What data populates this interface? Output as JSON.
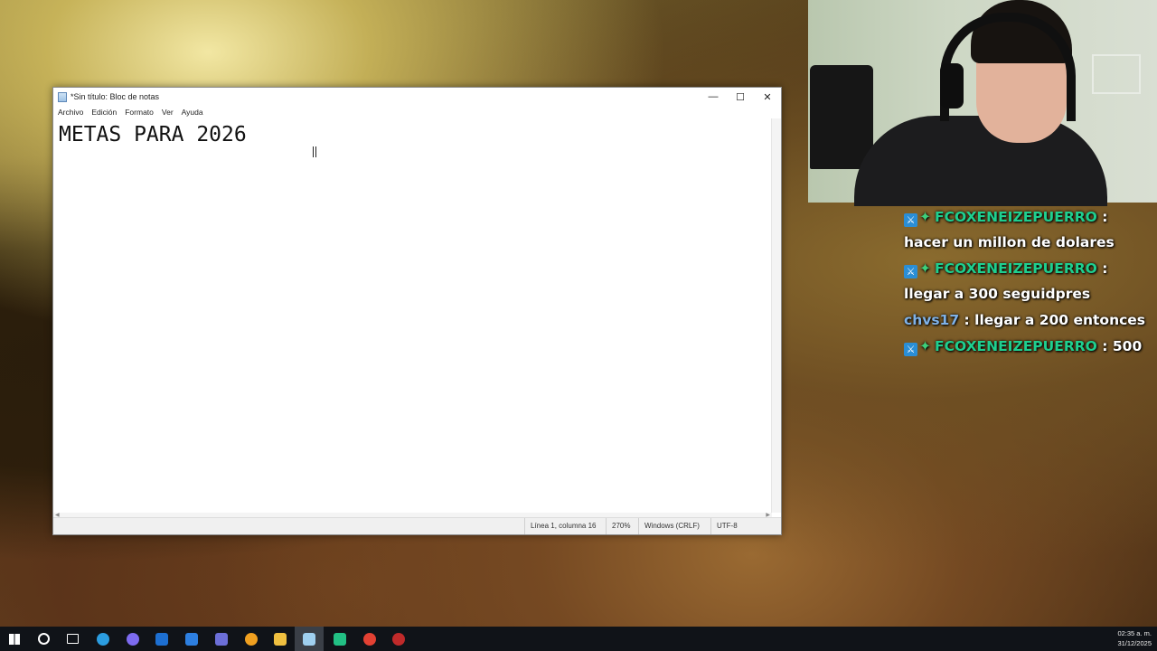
{
  "notepad": {
    "title": "*Sin título: Bloc de notas",
    "controls": {
      "minimize": "—",
      "maximize": "☐",
      "close": "✕"
    },
    "menu": [
      "Archivo",
      "Edición",
      "Formato",
      "Ver",
      "Ayuda"
    ],
    "content": "METAS PARA 2026",
    "status": {
      "position": "Línea 1, columna 16",
      "zoom": "270%",
      "line_ending": "Windows (CRLF)",
      "encoding": "UTF-8"
    }
  },
  "chat": {
    "messages": [
      {
        "user": "FCOXENEIZEPUERRO",
        "text": ": hacer un millon de dolares"
      },
      {
        "user": "FCOXENEIZEPUERRO",
        "text": ": llegar a 300 seguidpres"
      },
      {
        "user": "chvs17",
        "text": ": llegar a 200 entonces"
      },
      {
        "user": "FCOXENEIZEPUERRO",
        "text": ": 500"
      }
    ]
  },
  "taskbar": {
    "time": "02:35 a. m.",
    "date": "31/12/2025",
    "icons": [
      {
        "name": "start",
        "color": "#ffffff"
      },
      {
        "name": "search",
        "color": "#ffffff"
      },
      {
        "name": "task-view",
        "color": "#ffffff"
      },
      {
        "name": "edge",
        "color": "#2b9de0"
      },
      {
        "name": "copilot",
        "color": "#7d6bf0"
      },
      {
        "name": "outlook",
        "color": "#1d6fd1"
      },
      {
        "name": "store",
        "color": "#2d7fe0"
      },
      {
        "name": "teams",
        "color": "#6c6fd8"
      },
      {
        "name": "chrome-orange",
        "color": "#f0a020"
      },
      {
        "name": "file-explorer",
        "color": "#f0c040"
      },
      {
        "name": "notepad",
        "color": "#9fd0f0"
      },
      {
        "name": "green-app",
        "color": "#22c084"
      },
      {
        "name": "chrome",
        "color": "#e34133"
      },
      {
        "name": "obs",
        "color": "#c02a2a"
      }
    ]
  }
}
